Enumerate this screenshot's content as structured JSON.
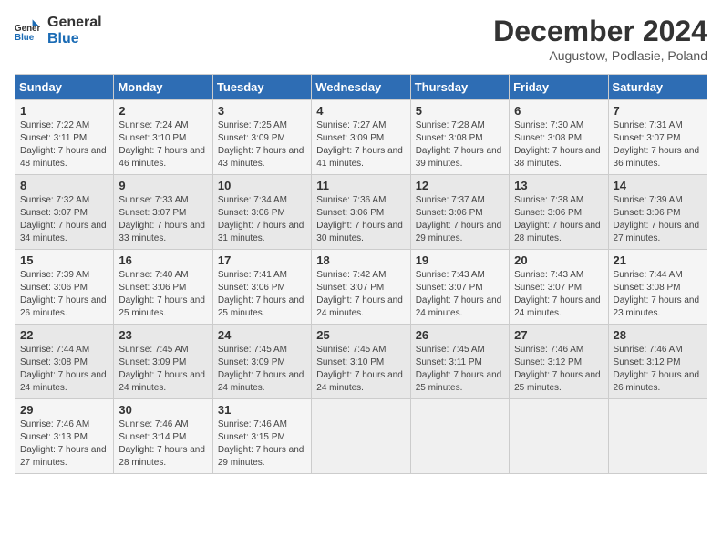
{
  "logo": {
    "text_general": "General",
    "text_blue": "Blue"
  },
  "title": "December 2024",
  "subtitle": "Augustow, Podlasie, Poland",
  "weekdays": [
    "Sunday",
    "Monday",
    "Tuesday",
    "Wednesday",
    "Thursday",
    "Friday",
    "Saturday"
  ],
  "weeks": [
    [
      {
        "day": "1",
        "sunrise": "Sunrise: 7:22 AM",
        "sunset": "Sunset: 3:11 PM",
        "daylight": "Daylight: 7 hours and 48 minutes."
      },
      {
        "day": "2",
        "sunrise": "Sunrise: 7:24 AM",
        "sunset": "Sunset: 3:10 PM",
        "daylight": "Daylight: 7 hours and 46 minutes."
      },
      {
        "day": "3",
        "sunrise": "Sunrise: 7:25 AM",
        "sunset": "Sunset: 3:09 PM",
        "daylight": "Daylight: 7 hours and 43 minutes."
      },
      {
        "day": "4",
        "sunrise": "Sunrise: 7:27 AM",
        "sunset": "Sunset: 3:09 PM",
        "daylight": "Daylight: 7 hours and 41 minutes."
      },
      {
        "day": "5",
        "sunrise": "Sunrise: 7:28 AM",
        "sunset": "Sunset: 3:08 PM",
        "daylight": "Daylight: 7 hours and 39 minutes."
      },
      {
        "day": "6",
        "sunrise": "Sunrise: 7:30 AM",
        "sunset": "Sunset: 3:08 PM",
        "daylight": "Daylight: 7 hours and 38 minutes."
      },
      {
        "day": "7",
        "sunrise": "Sunrise: 7:31 AM",
        "sunset": "Sunset: 3:07 PM",
        "daylight": "Daylight: 7 hours and 36 minutes."
      }
    ],
    [
      {
        "day": "8",
        "sunrise": "Sunrise: 7:32 AM",
        "sunset": "Sunset: 3:07 PM",
        "daylight": "Daylight: 7 hours and 34 minutes."
      },
      {
        "day": "9",
        "sunrise": "Sunrise: 7:33 AM",
        "sunset": "Sunset: 3:07 PM",
        "daylight": "Daylight: 7 hours and 33 minutes."
      },
      {
        "day": "10",
        "sunrise": "Sunrise: 7:34 AM",
        "sunset": "Sunset: 3:06 PM",
        "daylight": "Daylight: 7 hours and 31 minutes."
      },
      {
        "day": "11",
        "sunrise": "Sunrise: 7:36 AM",
        "sunset": "Sunset: 3:06 PM",
        "daylight": "Daylight: 7 hours and 30 minutes."
      },
      {
        "day": "12",
        "sunrise": "Sunrise: 7:37 AM",
        "sunset": "Sunset: 3:06 PM",
        "daylight": "Daylight: 7 hours and 29 minutes."
      },
      {
        "day": "13",
        "sunrise": "Sunrise: 7:38 AM",
        "sunset": "Sunset: 3:06 PM",
        "daylight": "Daylight: 7 hours and 28 minutes."
      },
      {
        "day": "14",
        "sunrise": "Sunrise: 7:39 AM",
        "sunset": "Sunset: 3:06 PM",
        "daylight": "Daylight: 7 hours and 27 minutes."
      }
    ],
    [
      {
        "day": "15",
        "sunrise": "Sunrise: 7:39 AM",
        "sunset": "Sunset: 3:06 PM",
        "daylight": "Daylight: 7 hours and 26 minutes."
      },
      {
        "day": "16",
        "sunrise": "Sunrise: 7:40 AM",
        "sunset": "Sunset: 3:06 PM",
        "daylight": "Daylight: 7 hours and 25 minutes."
      },
      {
        "day": "17",
        "sunrise": "Sunrise: 7:41 AM",
        "sunset": "Sunset: 3:06 PM",
        "daylight": "Daylight: 7 hours and 25 minutes."
      },
      {
        "day": "18",
        "sunrise": "Sunrise: 7:42 AM",
        "sunset": "Sunset: 3:07 PM",
        "daylight": "Daylight: 7 hours and 24 minutes."
      },
      {
        "day": "19",
        "sunrise": "Sunrise: 7:43 AM",
        "sunset": "Sunset: 3:07 PM",
        "daylight": "Daylight: 7 hours and 24 minutes."
      },
      {
        "day": "20",
        "sunrise": "Sunrise: 7:43 AM",
        "sunset": "Sunset: 3:07 PM",
        "daylight": "Daylight: 7 hours and 24 minutes."
      },
      {
        "day": "21",
        "sunrise": "Sunrise: 7:44 AM",
        "sunset": "Sunset: 3:08 PM",
        "daylight": "Daylight: 7 hours and 23 minutes."
      }
    ],
    [
      {
        "day": "22",
        "sunrise": "Sunrise: 7:44 AM",
        "sunset": "Sunset: 3:08 PM",
        "daylight": "Daylight: 7 hours and 24 minutes."
      },
      {
        "day": "23",
        "sunrise": "Sunrise: 7:45 AM",
        "sunset": "Sunset: 3:09 PM",
        "daylight": "Daylight: 7 hours and 24 minutes."
      },
      {
        "day": "24",
        "sunrise": "Sunrise: 7:45 AM",
        "sunset": "Sunset: 3:09 PM",
        "daylight": "Daylight: 7 hours and 24 minutes."
      },
      {
        "day": "25",
        "sunrise": "Sunrise: 7:45 AM",
        "sunset": "Sunset: 3:10 PM",
        "daylight": "Daylight: 7 hours and 24 minutes."
      },
      {
        "day": "26",
        "sunrise": "Sunrise: 7:45 AM",
        "sunset": "Sunset: 3:11 PM",
        "daylight": "Daylight: 7 hours and 25 minutes."
      },
      {
        "day": "27",
        "sunrise": "Sunrise: 7:46 AM",
        "sunset": "Sunset: 3:12 PM",
        "daylight": "Daylight: 7 hours and 25 minutes."
      },
      {
        "day": "28",
        "sunrise": "Sunrise: 7:46 AM",
        "sunset": "Sunset: 3:12 PM",
        "daylight": "Daylight: 7 hours and 26 minutes."
      }
    ],
    [
      {
        "day": "29",
        "sunrise": "Sunrise: 7:46 AM",
        "sunset": "Sunset: 3:13 PM",
        "daylight": "Daylight: 7 hours and 27 minutes."
      },
      {
        "day": "30",
        "sunrise": "Sunrise: 7:46 AM",
        "sunset": "Sunset: 3:14 PM",
        "daylight": "Daylight: 7 hours and 28 minutes."
      },
      {
        "day": "31",
        "sunrise": "Sunrise: 7:46 AM",
        "sunset": "Sunset: 3:15 PM",
        "daylight": "Daylight: 7 hours and 29 minutes."
      },
      null,
      null,
      null,
      null
    ]
  ]
}
